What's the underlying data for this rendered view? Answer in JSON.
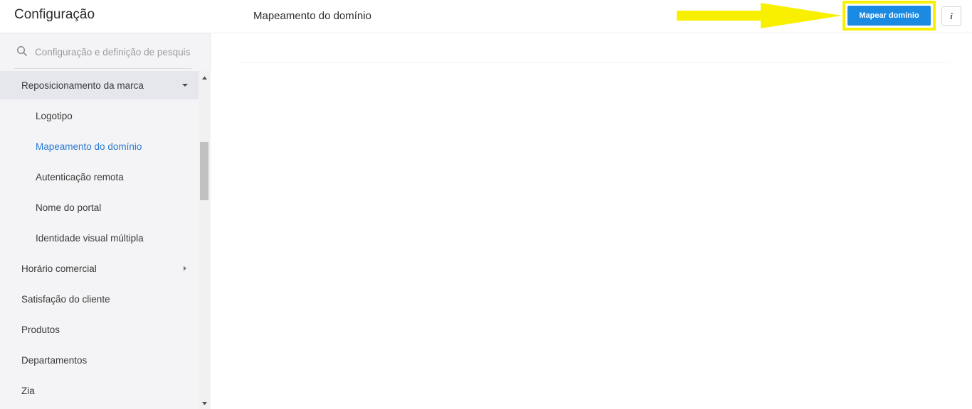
{
  "sidebar": {
    "title": "Configuração",
    "search": {
      "placeholder": "Configuração e definição de pesquisa"
    },
    "items": [
      {
        "label": "Reposicionamento da marca",
        "level": "parent",
        "state": "expanded"
      },
      {
        "label": "Logotipo",
        "level": "child"
      },
      {
        "label": "Mapeamento do domínio",
        "level": "child",
        "state": "active"
      },
      {
        "label": "Autenticação remota",
        "level": "child"
      },
      {
        "label": "Nome do portal",
        "level": "child"
      },
      {
        "label": "Identidade visual múltipla",
        "level": "child"
      },
      {
        "label": "Horário comercial",
        "level": "parent",
        "state": "collapsed"
      },
      {
        "label": "Satisfação do cliente",
        "level": "parent"
      },
      {
        "label": "Produtos",
        "level": "parent"
      },
      {
        "label": "Departamentos",
        "level": "parent"
      },
      {
        "label": "Zia",
        "level": "parent"
      }
    ]
  },
  "header": {
    "page_title": "Mapeamento do domínio",
    "primary_button_label": "Mapear domínio",
    "info_button_label": "i"
  },
  "colors": {
    "accent": "#1a8ae3",
    "active_link": "#2b7bd3",
    "annotation": "#f9f000",
    "sidebar_bg": "#f4f4f6"
  }
}
